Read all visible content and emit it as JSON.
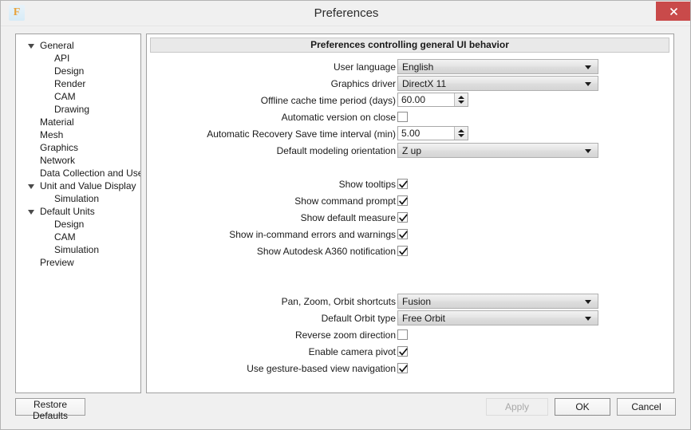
{
  "window": {
    "title": "Preferences",
    "app_icon": "fusion-f-icon",
    "app_icon_glyph": "F",
    "close_icon": "close-icon",
    "close_button_color": "#c94a4a"
  },
  "sidebar": {
    "items": [
      {
        "label": "General",
        "level": 1,
        "expandable": true,
        "expanded": true
      },
      {
        "label": "API",
        "level": 2,
        "expandable": false,
        "expanded": false
      },
      {
        "label": "Design",
        "level": 2,
        "expandable": false,
        "expanded": false
      },
      {
        "label": "Render",
        "level": 2,
        "expandable": false,
        "expanded": false
      },
      {
        "label": "CAM",
        "level": 2,
        "expandable": false,
        "expanded": false
      },
      {
        "label": "Drawing",
        "level": 2,
        "expandable": false,
        "expanded": false
      },
      {
        "label": "Material",
        "level": 1,
        "expandable": false,
        "expanded": false
      },
      {
        "label": "Mesh",
        "level": 1,
        "expandable": false,
        "expanded": false
      },
      {
        "label": "Graphics",
        "level": 1,
        "expandable": false,
        "expanded": false
      },
      {
        "label": "Network",
        "level": 1,
        "expandable": false,
        "expanded": false
      },
      {
        "label": "Data Collection and Use",
        "level": 1,
        "expandable": false,
        "expanded": false
      },
      {
        "label": "Unit and Value Display",
        "level": 1,
        "expandable": true,
        "expanded": true
      },
      {
        "label": "Simulation",
        "level": 2,
        "expandable": false,
        "expanded": false
      },
      {
        "label": "Default Units",
        "level": 1,
        "expandable": true,
        "expanded": true
      },
      {
        "label": "Design",
        "level": 2,
        "expandable": false,
        "expanded": false
      },
      {
        "label": "CAM",
        "level": 2,
        "expandable": false,
        "expanded": false
      },
      {
        "label": "Simulation",
        "level": 2,
        "expandable": false,
        "expanded": false
      },
      {
        "label": "Preview",
        "level": 1,
        "expandable": false,
        "expanded": false
      }
    ]
  },
  "content": {
    "header": "Preferences controlling general UI behavior",
    "rows": [
      {
        "label": "User language",
        "type": "combo",
        "value": "English"
      },
      {
        "label": "Graphics driver",
        "type": "combo",
        "value": "DirectX 11"
      },
      {
        "label": "Offline cache time period (days)",
        "type": "spin",
        "value": "60.00"
      },
      {
        "label": "Automatic version on close",
        "type": "checkbox",
        "checked": false
      },
      {
        "label": "Automatic Recovery Save time interval (min)",
        "type": "spin",
        "value": "5.00"
      },
      {
        "label": "Default modeling orientation",
        "type": "combo",
        "value": "Z up"
      },
      {
        "type": "spacer"
      },
      {
        "label": "Show tooltips",
        "type": "checkbox",
        "checked": true
      },
      {
        "label": "Show command prompt",
        "type": "checkbox",
        "checked": true
      },
      {
        "label": "Show default measure",
        "type": "checkbox",
        "checked": true
      },
      {
        "label": "Show in-command errors and warnings",
        "type": "checkbox",
        "checked": true
      },
      {
        "label": "Show Autodesk A360 notification",
        "type": "checkbox",
        "checked": true
      },
      {
        "type": "spacer"
      },
      {
        "type": "spacer"
      },
      {
        "label": "Pan, Zoom, Orbit shortcuts",
        "type": "combo",
        "value": "Fusion"
      },
      {
        "label": "Default Orbit type",
        "type": "combo",
        "value": "Free Orbit"
      },
      {
        "label": "Reverse zoom direction",
        "type": "checkbox",
        "checked": false
      },
      {
        "label": "Enable camera pivot",
        "type": "checkbox",
        "checked": true
      },
      {
        "label": "Use gesture-based view navigation",
        "type": "checkbox",
        "checked": true
      }
    ]
  },
  "footer": {
    "restore_defaults": "Restore Defaults",
    "apply": "Apply",
    "apply_enabled": false,
    "ok": "OK",
    "cancel": "Cancel"
  }
}
